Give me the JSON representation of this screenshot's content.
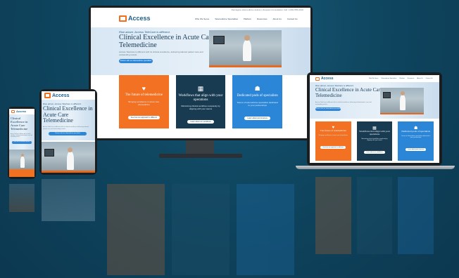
{
  "site": {
    "logo_text": "Access",
    "logo_sub": "TeleCare",
    "topbar_text": "Reimagine telemedicine delivery, Request Consultation    Call: 1-800-555-0100",
    "nav": [
      "Who We Serve",
      "Telemedicine Specialties",
      "Platform",
      "Resources",
      "About Us",
      "Contact Us"
    ],
    "kicker": "Rise above. Access TeleCare is different.",
    "title": "Clinical Excellence in Acute Care Telemedicine",
    "description": "Access TeleCare is different with its clinical excellence, delivering tailored patient care and outstanding results.",
    "cta": "Partner with our telemedicine specialists",
    "cards": [
      {
        "icon": "heart-pulse-icon",
        "title": "The future of telemedicine",
        "body": "Bringing excellence in acute care telemedicine",
        "button": "See how our approach is different"
      },
      {
        "icon": "puzzle-icon",
        "title": "Workflows that align with your operations",
        "body": "Minimizing clinical workflow complexity by aligning with your teams",
        "button": "Learn about our workflows"
      },
      {
        "icon": "user-group-icon",
        "title": "Dedicated pods of specialists",
        "body": "Teams of telemedicine specialists dedicated to your partnerships",
        "button": "Learn about pod structure"
      }
    ]
  },
  "colors": {
    "background": "#0d3a52",
    "orange": "#f27122",
    "navy": "#183b52",
    "blue": "#2b86d8",
    "cta": "#2d86d6"
  }
}
